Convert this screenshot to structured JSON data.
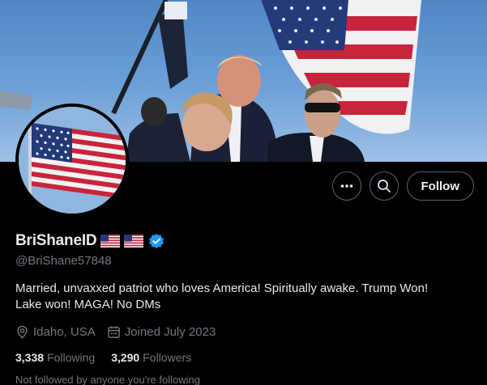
{
  "banner": {
    "description_icon": "banner-image"
  },
  "avatar": {
    "icon": "avatar-flag-image"
  },
  "actions": {
    "more_icon": "more-icon",
    "search_icon": "search-icon",
    "follow_label": "Follow"
  },
  "profile": {
    "display_name": "BriShaneID",
    "handle": "@BriShane57848",
    "verified_icon": "verified-badge-icon",
    "bio": "Married, unvaxxed patriot who loves America!  Spiritually awake. Trump Won! Lake won! MAGA! No DMs",
    "location": "Idaho, USA",
    "joined": "Joined July 2023",
    "following_count": "3,338",
    "following_label": "Following",
    "followers_count": "3,290",
    "followers_label": "Followers",
    "mutuals_text": "Not followed by anyone you're following"
  },
  "colors": {
    "background": "#000000",
    "text_primary": "#e7e9ea",
    "text_secondary": "#71767b",
    "verified_blue": "#1d9bf0",
    "button_border": "#536471"
  }
}
